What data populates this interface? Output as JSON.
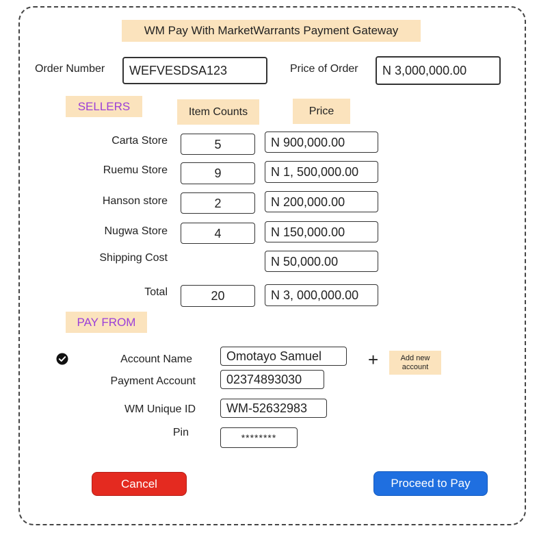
{
  "title": "WM Pay With MarketWarrants Payment Gateway",
  "order": {
    "number_label": "Order Number",
    "number_value": "WEFVESDSA123",
    "price_label": "Price of Order",
    "price_value": "N 3,000,000.00"
  },
  "sellers": {
    "header": "SELLERS",
    "count_header": "Item Counts",
    "price_header": "Price",
    "rows": [
      {
        "name": "Carta Store",
        "count": "5",
        "price": "N 900,000.00"
      },
      {
        "name": "Ruemu Store",
        "count": "9",
        "price": "N 1, 500,000.00"
      },
      {
        "name": "Hanson store",
        "count": "2",
        "price": "N 200,000.00"
      },
      {
        "name": "Nugwa Store",
        "count": "4",
        "price": "N 150,000.00"
      }
    ],
    "shipping_label": "Shipping Cost",
    "shipping_price": "N 50,000.00",
    "total_label": "Total",
    "total_count": "20",
    "total_price": "N 3, 000,000.00"
  },
  "pay_from": {
    "header": "PAY FROM",
    "account_name_label": "Account Name",
    "account_name_value": "Omotayo Samuel",
    "payment_account_label": "Payment Account",
    "payment_account_value": "02374893030",
    "unique_id_label": "WM Unique ID",
    "unique_id_value": "WM-52632983",
    "pin_label": "Pin",
    "pin_value": "********",
    "add_account_line1": "Add new",
    "add_account_line2": "account",
    "plus_symbol": "+"
  },
  "buttons": {
    "cancel": "Cancel",
    "proceed": "Proceed to Pay"
  },
  "colors": {
    "accent_tag": "#fbe3bd",
    "cancel": "#e42a20",
    "proceed": "#1f6fe0",
    "purple_text": "#9b3fd8"
  }
}
